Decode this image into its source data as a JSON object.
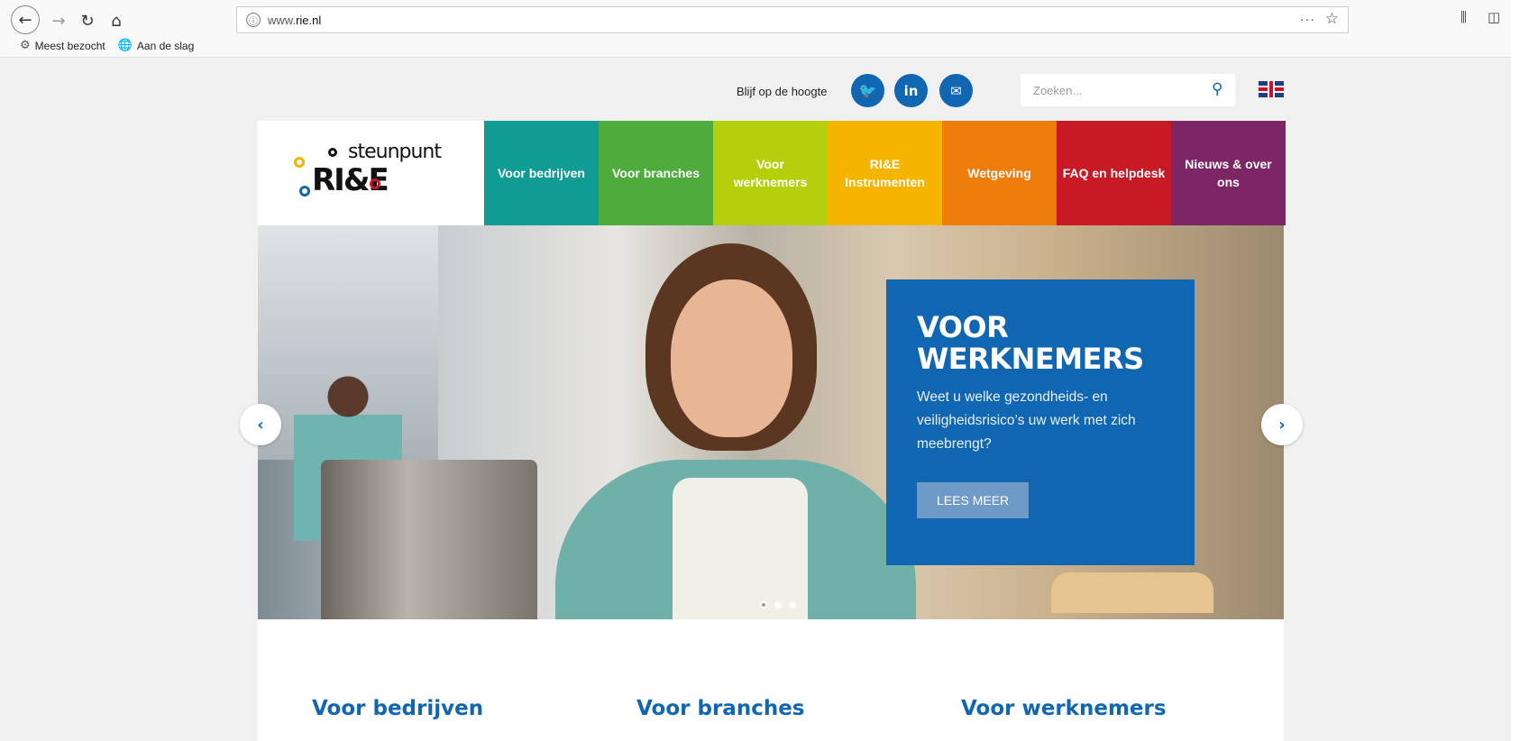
{
  "browser": {
    "url_prefix": "www.",
    "url_domain": "rie.nl",
    "info_icon": "ⓘ",
    "more_label": "···",
    "bookmarks": [
      {
        "label": "Meest bezocht",
        "icon": "gear-icon"
      },
      {
        "label": "Aan de slag",
        "icon": "globe-icon"
      }
    ]
  },
  "topbar": {
    "follow_text": "Blijf op de hoogte",
    "social": [
      {
        "name": "twitter",
        "glyph": "🐦"
      },
      {
        "name": "linkedin",
        "glyph": "in"
      },
      {
        "name": "email",
        "glyph": "✉"
      }
    ],
    "search_placeholder": "Zoeken...",
    "language": "EN"
  },
  "logo": {
    "line1": "steunpunt",
    "line2": "RI&E"
  },
  "menu": [
    {
      "label": "Voor bedrijven",
      "color": "#119b95"
    },
    {
      "label": "Voor branches",
      "color": "#4dac3c"
    },
    {
      "label": "Voor werknemers",
      "color": "#b5cf0c"
    },
    {
      "label": "RI&E Instrumenten",
      "color": "#f5b400"
    },
    {
      "label": "Wetgeving",
      "color": "#ee7c0b"
    },
    {
      "label": "FAQ en helpdesk",
      "color": "#c71a24"
    },
    {
      "label": "Nieuws & over ons",
      "color": "#7d2665"
    }
  ],
  "slider": {
    "title": "VOOR WERKNEMERS",
    "text": "Weet u welke gezondheids- en veiligheidsrisico’s uw werk met zich meebrengt?",
    "button": "LEES MEER",
    "active_index": 0,
    "slide_count": 3
  },
  "columns": [
    {
      "title": "Voor bedrijven"
    },
    {
      "title": "Voor branches"
    },
    {
      "title": "Voor werknemers"
    }
  ],
  "colors": {
    "brand_blue": "#1066b0"
  }
}
